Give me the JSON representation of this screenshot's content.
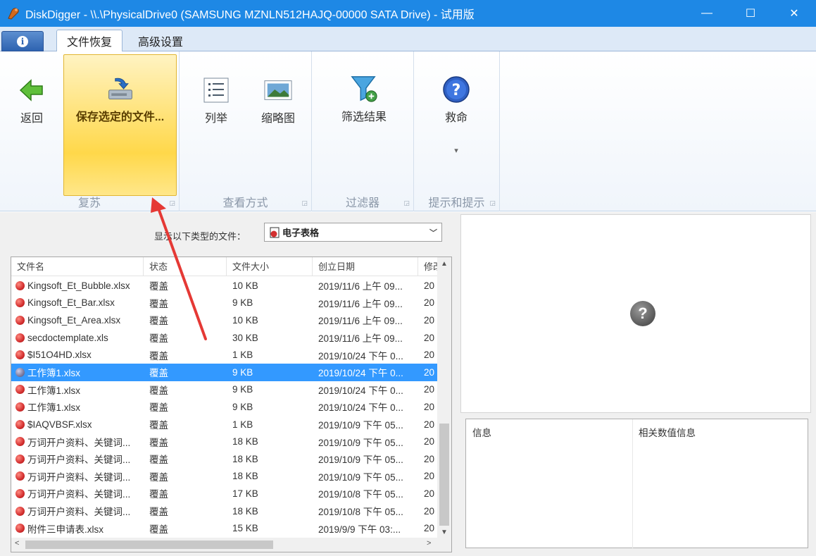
{
  "window": {
    "title": "DiskDigger - \\\\.\\PhysicalDrive0 (SAMSUNG MZNLN512HAJQ-00000 SATA Drive) - 试用版",
    "minimize": "—",
    "maximize": "☐",
    "close": "✕"
  },
  "tabs": [
    {
      "label": "文件恢复",
      "active": true
    },
    {
      "label": "高级设置",
      "active": false
    }
  ],
  "ribbon": {
    "back_label": "返回",
    "save_label": "保存选定的文件...",
    "group_recover": "复苏",
    "list_label": "列举",
    "thumb_label": "缩略图",
    "group_view": "查看方式",
    "filter_label": "筛选结果",
    "group_filter": "过滤器",
    "help_label": "救命",
    "help_dropdown": "▾",
    "group_tips": "提示和提示"
  },
  "filter": {
    "label": "显示以下类型的文件：",
    "selected": "电子表格"
  },
  "columns": [
    "文件名",
    "状态",
    "文件大小",
    "创立日期",
    "修改"
  ],
  "rows": [
    {
      "name": "Kingsoft_Et_Bubble.xlsx",
      "status": "覆盖",
      "size": "10 KB",
      "created": "2019/11/6 上午 09...",
      "mod": "20",
      "selected": false
    },
    {
      "name": "Kingsoft_Et_Bar.xlsx",
      "status": "覆盖",
      "size": "9 KB",
      "created": "2019/11/6 上午 09...",
      "mod": "20",
      "selected": false
    },
    {
      "name": "Kingsoft_Et_Area.xlsx",
      "status": "覆盖",
      "size": "10 KB",
      "created": "2019/11/6 上午 09...",
      "mod": "20",
      "selected": false
    },
    {
      "name": "secdoctemplate.xls",
      "status": "覆盖",
      "size": "30 KB",
      "created": "2019/11/6 上午 09...",
      "mod": "20",
      "selected": false
    },
    {
      "name": "$I51O4HD.xlsx",
      "status": "覆盖",
      "size": "1 KB",
      "created": "2019/10/24 下午 0...",
      "mod": "20",
      "selected": false
    },
    {
      "name": "工作簿1.xlsx",
      "status": "覆盖",
      "size": "9 KB",
      "created": "2019/10/24 下午 0...",
      "mod": "20",
      "selected": true
    },
    {
      "name": "工作簿1.xlsx",
      "status": "覆盖",
      "size": "9 KB",
      "created": "2019/10/24 下午 0...",
      "mod": "20",
      "selected": false
    },
    {
      "name": "工作簿1.xlsx",
      "status": "覆盖",
      "size": "9 KB",
      "created": "2019/10/24 下午 0...",
      "mod": "20",
      "selected": false
    },
    {
      "name": "$IAQVBSF.xlsx",
      "status": "覆盖",
      "size": "1 KB",
      "created": "2019/10/9 下午 05...",
      "mod": "20",
      "selected": false
    },
    {
      "name": "万词开户资料、关键词...",
      "status": "覆盖",
      "size": "18 KB",
      "created": "2019/10/9 下午 05...",
      "mod": "20",
      "selected": false
    },
    {
      "name": "万词开户资料、关键词...",
      "status": "覆盖",
      "size": "18 KB",
      "created": "2019/10/9 下午 05...",
      "mod": "20",
      "selected": false
    },
    {
      "name": "万词开户资料、关键词...",
      "status": "覆盖",
      "size": "18 KB",
      "created": "2019/10/9 下午 05...",
      "mod": "20",
      "selected": false
    },
    {
      "name": "万词开户资料、关键词...",
      "status": "覆盖",
      "size": "17 KB",
      "created": "2019/10/8 下午 05...",
      "mod": "20",
      "selected": false
    },
    {
      "name": "万词开户资料、关键词...",
      "status": "覆盖",
      "size": "18 KB",
      "created": "2019/10/8 下午 05...",
      "mod": "20",
      "selected": false
    },
    {
      "name": "附件三申请表.xlsx",
      "status": "覆盖",
      "size": "15 KB",
      "created": "2019/9/9 下午 03:...",
      "mod": "20",
      "selected": false
    }
  ],
  "info_table": {
    "col1": "信息",
    "col2": "相关数值信息"
  },
  "colors": {
    "titlebar": "#1e88e5",
    "selection": "#3399ff",
    "highlight": "#ffd84a",
    "annotation": "#e53935"
  }
}
